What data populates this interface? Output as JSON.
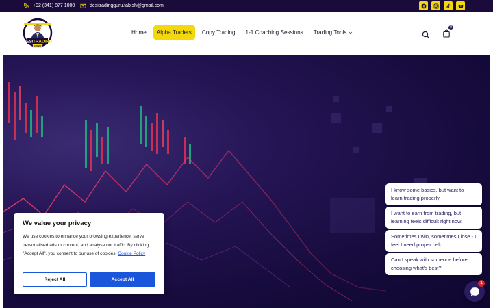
{
  "topbar": {
    "phone": "+92 (341) 877 1000",
    "email": "desitradingguru.tabish@gmail.com",
    "phone_icon": "phone-icon",
    "email_icon": "envelope-icon",
    "socials": [
      "facebook-icon",
      "instagram-icon",
      "tiktok-icon",
      "youtube-icon"
    ]
  },
  "header": {
    "logo_text_top": "DESI",
    "logo_text_main": "TRADING",
    "logo_text_sub": "GURU",
    "nav": [
      {
        "label": "Home"
      },
      {
        "label": "Alpha Traders"
      },
      {
        "label": "Copy Trading"
      },
      {
        "label": "1-1 Coaching Sessions"
      },
      {
        "label": "Trading Tools"
      }
    ],
    "cart_count": "0"
  },
  "cookie": {
    "title": "We value your privacy",
    "body": "We use cookies to enhance your browsing experience, serve personalised ads or content, and analyse our traffic. By clicking \"Accept All\", you consent to our use of cookies.",
    "policy_link": "Cookie Policy",
    "reject_label": "Reject All",
    "accept_label": "Accept All"
  },
  "chat": {
    "suggestions": [
      "I know some basics, but want to learn trading properly.",
      "I want to earn from trading, but learning feels difficult right now.",
      "Sometimes I win, sometimes I lose - I feel I need proper help.",
      "Can I speak with someone before choosing what's best?"
    ],
    "unread": "1"
  },
  "colors": {
    "brand_dark": "#1a0b3b",
    "accent_yellow": "#f3d90c",
    "accept_blue": "#1a56db"
  }
}
